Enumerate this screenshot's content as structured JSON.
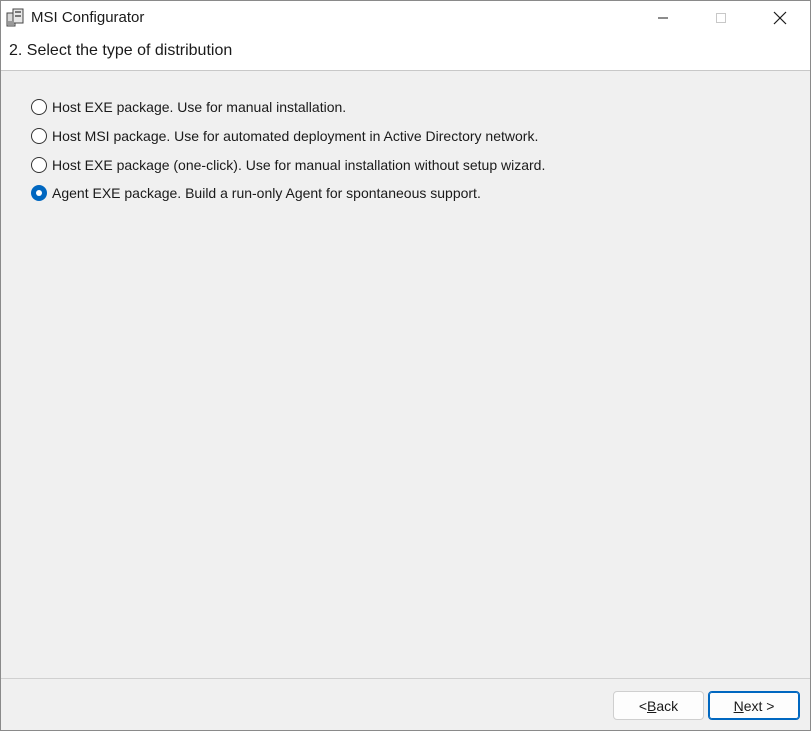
{
  "window": {
    "title": "MSI Configurator",
    "controls": {
      "minimize_icon": "minimize-icon",
      "maximize_icon": "maximize-icon",
      "close_icon": "close-icon"
    }
  },
  "header": {
    "step_title": "2. Select the type of distribution"
  },
  "options": [
    {
      "label": "Host EXE package. Use for manual installation.",
      "selected": false
    },
    {
      "label": "Host MSI package. Use for automated deployment in Active Directory network.",
      "selected": false
    },
    {
      "label": "Host EXE package (one-click). Use for manual installation without setup wizard.",
      "selected": false
    },
    {
      "label": "Agent EXE package. Build a run-only Agent for spontaneous support.",
      "selected": true
    }
  ],
  "footer": {
    "back_prefix": "< ",
    "back_accel": "B",
    "back_rest": "ack",
    "next_accel": "N",
    "next_rest": "ext >"
  },
  "colors": {
    "accent": "#0067c0",
    "dialog_bg": "#f0f0f0",
    "header_bg": "#ffffff"
  }
}
